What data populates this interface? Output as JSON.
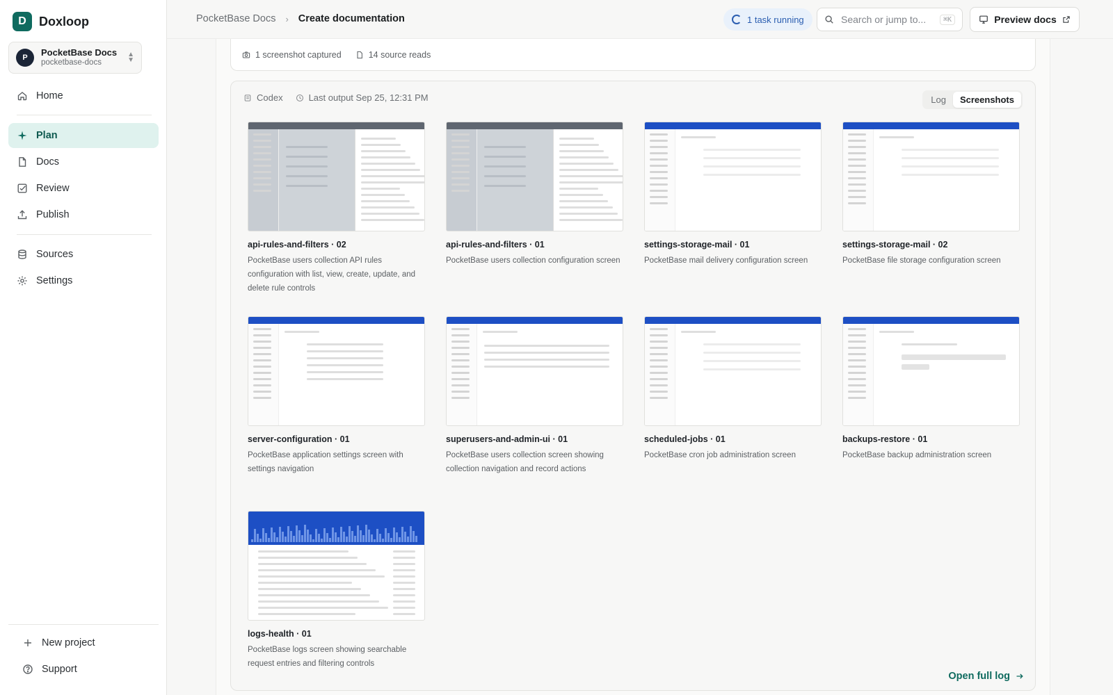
{
  "brand": {
    "initial": "D",
    "name": "Doxloop"
  },
  "project": {
    "avatar": "P",
    "name": "PocketBase Docs",
    "slug": "pocketbase-docs"
  },
  "nav": [
    {
      "label": "Home",
      "icon": "home-icon",
      "active": false
    },
    {
      "label": "Plan",
      "icon": "sparkle-icon",
      "active": true
    },
    {
      "label": "Docs",
      "icon": "document-icon",
      "active": false
    },
    {
      "label": "Review",
      "icon": "checkbox-icon",
      "active": false
    },
    {
      "label": "Publish",
      "icon": "upload-icon",
      "active": false
    },
    {
      "label": "Sources",
      "icon": "database-icon",
      "active": false
    },
    {
      "label": "Settings",
      "icon": "gear-icon",
      "active": false
    }
  ],
  "sidebar_bottom": {
    "new_project": "New project",
    "support": "Support"
  },
  "breadcrumb": {
    "parent": "PocketBase Docs",
    "current": "Create documentation"
  },
  "task_badge": "1 task running",
  "search": {
    "placeholder": "Search or jump to...",
    "shortcut": "⌘K"
  },
  "preview_button": "Preview docs",
  "stats": {
    "screenshots": "1 screenshot captured",
    "source_reads": "14 source reads"
  },
  "panel": {
    "agent": "Codex",
    "last_output": "Last output Sep 25, 12:31 PM",
    "tabs": [
      "Log",
      "Screenshots"
    ],
    "active_tab": "Screenshots",
    "open_full_log": "Open full log"
  },
  "screenshots": [
    {
      "title": "api-rules-and-filters · 02",
      "desc": "PocketBase users collection API rules configuration with list, view, create, update, and delete rule controls",
      "style": "gray-drawer"
    },
    {
      "title": "api-rules-and-filters · 01",
      "desc": "PocketBase users collection configuration screen",
      "style": "gray-drawer"
    },
    {
      "title": "settings-storage-mail · 01",
      "desc": "PocketBase mail delivery configuration screen",
      "style": "settings"
    },
    {
      "title": "settings-storage-mail · 02",
      "desc": "PocketBase file storage configuration screen",
      "style": "settings"
    },
    {
      "title": "server-configuration · 01",
      "desc": "PocketBase application settings screen with settings navigation",
      "style": "settings-form"
    },
    {
      "title": "superusers-and-admin-ui · 01",
      "desc": "PocketBase users collection screen showing collection navigation and record actions",
      "style": "table"
    },
    {
      "title": "scheduled-jobs · 01",
      "desc": "PocketBase cron job administration screen",
      "style": "settings"
    },
    {
      "title": "backups-restore · 01",
      "desc": "PocketBase backup administration screen",
      "style": "backups"
    },
    {
      "title": "logs-health · 01",
      "desc": "PocketBase logs screen showing searchable request entries and filtering controls",
      "style": "logs"
    }
  ],
  "colors": {
    "accent": "#0f6b5f",
    "active_nav_bg": "#dff2ee",
    "thumb_header": "#1d4fc4",
    "task_badge_bg": "#e9f1fb"
  }
}
